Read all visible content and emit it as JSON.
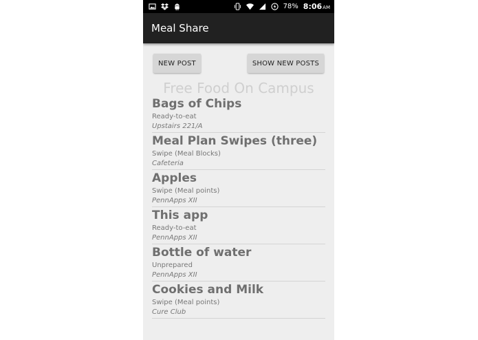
{
  "status_bar": {
    "icons_left": [
      "image-icon",
      "dropbox-icon",
      "android-icon"
    ],
    "icons_right": [
      "vibrate-icon",
      "wifi-icon",
      "signal-icon",
      "battery-icon"
    ],
    "battery": "78%",
    "time": "8:06",
    "ampm": "AM"
  },
  "app_bar": {
    "title": "Meal Share"
  },
  "actions": {
    "new_post": "NEW POST",
    "show_new_posts": "SHOW NEW POSTS"
  },
  "section": {
    "title": "Free Food On Campus"
  },
  "posts": [
    {
      "title": "Bags of Chips",
      "type": "Ready-to-eat",
      "location": "Upstairs 221/A"
    },
    {
      "title": "Meal Plan Swipes (three)",
      "type": "Swipe (Meal Blocks)",
      "location": "Cafeteria"
    },
    {
      "title": "Apples",
      "type": "Swipe (Meal points)",
      "location": "PennApps XII"
    },
    {
      "title": "This app",
      "type": "Ready-to-eat",
      "location": "PennApps XII"
    },
    {
      "title": "Bottle of water",
      "type": "Unprepared",
      "location": "PennApps XII"
    },
    {
      "title": "Cookies and Milk",
      "type": "Swipe (Meal points)",
      "location": "Cure Club"
    }
  ],
  "colors": {
    "status_bar_bg": "#000000",
    "app_bar_bg": "#212121",
    "screen_bg": "#eeeeee",
    "button_bg": "#d6d6d6",
    "title_text": "#6f6f6f",
    "section_title_text": "#cfcfcf"
  }
}
